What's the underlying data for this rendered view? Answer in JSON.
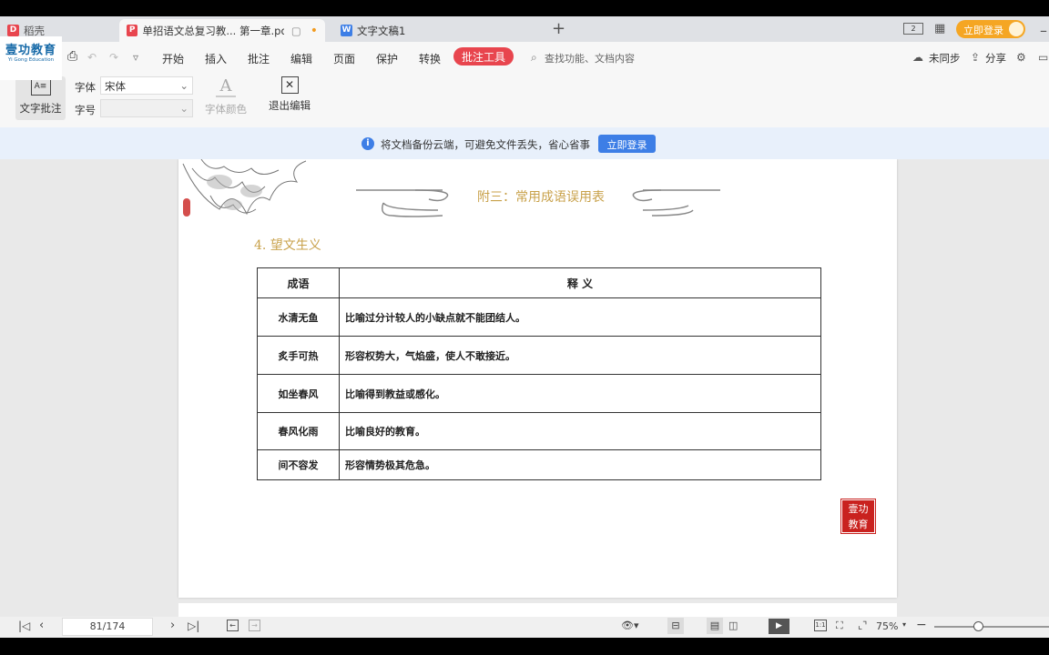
{
  "tabs": [
    {
      "label": "稻壳"
    },
    {
      "label": "单招语文总复习教... 第一章.pdf"
    },
    {
      "label": "文字文稿1"
    }
  ],
  "new_tab": "+",
  "top_right": {
    "login": "立即登录"
  },
  "logo": {
    "cn": "壹功教育",
    "en": "Yi Gong Education"
  },
  "menu": [
    "开始",
    "插入",
    "批注",
    "编辑",
    "页面",
    "保护",
    "转换"
  ],
  "active_tool": "批注工具",
  "search_placeholder": "查找功能、文档内容",
  "sync": "未同步",
  "share": "分享",
  "ribbon": {
    "text_annot": "文字批注",
    "font_label": "字体",
    "font_value": "宋体",
    "size_label": "字号",
    "size_value": "",
    "font_color": "字体颜色",
    "exit_edit": "退出编辑"
  },
  "banner": {
    "text": "将文档备份云端，可避免文件丢失，省心省事",
    "button": "立即登录"
  },
  "doc": {
    "header": "附三：常用成语误用表",
    "section": "4. 望文生义",
    "table_headers": [
      "成语",
      "释 义"
    ],
    "rows": [
      {
        "idiom": "水清无鱼",
        "meaning": "比喻过分计较人的小缺点就不能团结人。"
      },
      {
        "idiom": "炙手可热",
        "meaning": "形容权势大，气焰盛，使人不敢接近。"
      },
      {
        "idiom": "如坐春风",
        "meaning": "比喻得到教益或感化。"
      },
      {
        "idiom": "春风化雨",
        "meaning": "比喻良好的教育。"
      },
      {
        "idiom": "间不容发",
        "meaning": "形容情势极其危急。"
      }
    ],
    "seal_text": "壹功教育"
  },
  "status": {
    "page": "81/174",
    "zoom": "75%"
  },
  "colors": {
    "accent": "#e8454e",
    "blue": "#3d7ee6",
    "heading_gold": "#c8a14a",
    "seal_red": "#c9221f"
  }
}
